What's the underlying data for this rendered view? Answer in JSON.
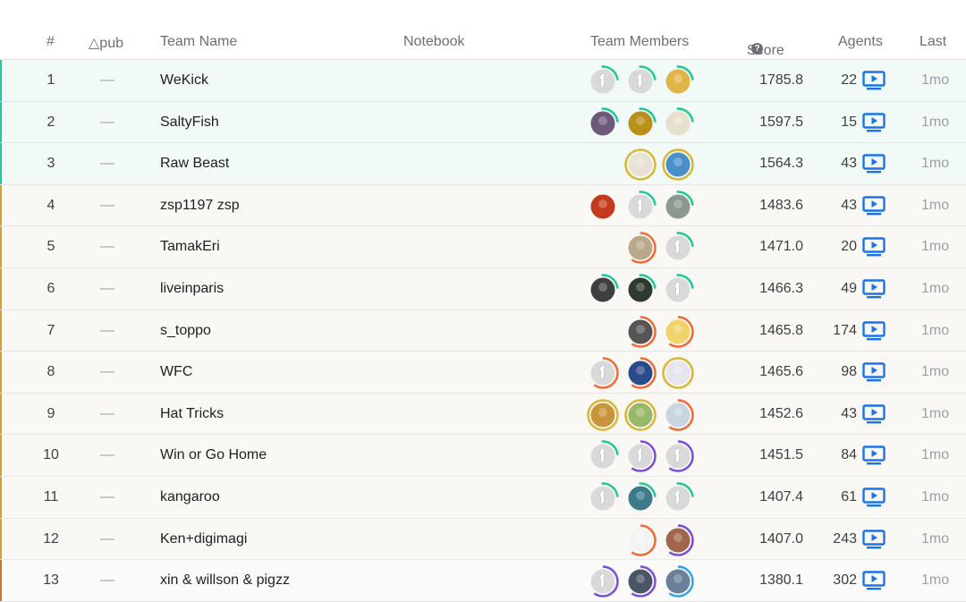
{
  "header": {
    "rank": "#",
    "delta": "△pub",
    "team_name": "Team Name",
    "notebook": "Notebook",
    "team_members": "Team Members",
    "score": "Score",
    "agents": "Agents",
    "last": "Last"
  },
  "icons": {
    "score_help": "question-circle-icon",
    "watch": "play-episode-icon"
  },
  "colors": {
    "gold_tier": "#20c997",
    "silver_tier": "#d69e2e",
    "bronze_tier": "#c7792a",
    "watch_blue": "#1a73e8",
    "tier_ring_green": "#20c997",
    "tier_ring_orange": "#f06a35",
    "tier_ring_purple": "#7b4ddb",
    "tier_ring_gold": "#d9b634",
    "tier_ring_blue": "#2fa4e7"
  },
  "rows": [
    {
      "rank": "1",
      "delta": "—",
      "team": "WeKick",
      "score": "1785.8",
      "agents": "22",
      "last": "1mo",
      "tier": "gold",
      "members": [
        {
          "ring": "green",
          "fill": "#d9d9d9",
          "kind": "goose"
        },
        {
          "ring": "green",
          "fill": "#d9d9d9",
          "kind": "goose"
        },
        {
          "ring": "green",
          "fill": "#e0b548",
          "kind": "photo"
        }
      ]
    },
    {
      "rank": "2",
      "delta": "—",
      "team": "SaltyFish",
      "score": "1597.5",
      "agents": "15",
      "last": "1mo",
      "tier": "gold",
      "members": [
        {
          "ring": "green",
          "fill": "#6d5a7a",
          "kind": "photo"
        },
        {
          "ring": "green",
          "fill": "#b8901a",
          "kind": "photo"
        },
        {
          "ring": "green",
          "fill": "#e4e0cc",
          "kind": "photo"
        }
      ]
    },
    {
      "rank": "3",
      "delta": "—",
      "team": "Raw Beast",
      "score": "1564.3",
      "agents": "43",
      "last": "1mo",
      "tier": "gold",
      "members": [
        {
          "ring": "gold",
          "fill": "#e9e2d4",
          "kind": "photo"
        },
        {
          "ring": "gold",
          "fill": "#4a90c8",
          "kind": "photo"
        }
      ]
    },
    {
      "rank": "4",
      "delta": "—",
      "team": "zsp1197 zsp",
      "score": "1483.6",
      "agents": "43",
      "last": "1mo",
      "tier": "silver",
      "members": [
        {
          "ring": "none",
          "fill": "#c43a1c",
          "kind": "photo"
        },
        {
          "ring": "green",
          "fill": "#d9d9d9",
          "kind": "goose"
        },
        {
          "ring": "green",
          "fill": "#8a9a90",
          "kind": "photo"
        }
      ]
    },
    {
      "rank": "5",
      "delta": "—",
      "team": "TamakEri",
      "score": "1471.0",
      "agents": "20",
      "last": "1mo",
      "tier": "silver",
      "members": [
        {
          "ring": "orange",
          "fill": "#b9a88a",
          "kind": "photo"
        },
        {
          "ring": "green",
          "fill": "#d9d9d9",
          "kind": "goose"
        }
      ]
    },
    {
      "rank": "6",
      "delta": "—",
      "team": "liveinparis",
      "score": "1466.3",
      "agents": "49",
      "last": "1mo",
      "tier": "silver",
      "members": [
        {
          "ring": "green",
          "fill": "#3f3f3f",
          "kind": "photo"
        },
        {
          "ring": "green",
          "fill": "#2f3a2e",
          "kind": "photo"
        },
        {
          "ring": "green",
          "fill": "#d9d9d9",
          "kind": "goose"
        }
      ]
    },
    {
      "rank": "7",
      "delta": "—",
      "team": "s_toppo",
      "score": "1465.8",
      "agents": "174",
      "last": "1mo",
      "tier": "silver",
      "members": [
        {
          "ring": "orange",
          "fill": "#555555",
          "kind": "photo"
        },
        {
          "ring": "orange",
          "fill": "#f2d36a",
          "kind": "photo"
        }
      ]
    },
    {
      "rank": "8",
      "delta": "—",
      "team": "WFC",
      "score": "1465.6",
      "agents": "98",
      "last": "1mo",
      "tier": "silver",
      "members": [
        {
          "ring": "orange",
          "fill": "#d9d9d9",
          "kind": "goose"
        },
        {
          "ring": "orange",
          "fill": "#2a4a8a",
          "kind": "photo"
        },
        {
          "ring": "gold",
          "fill": "#e8e4ee",
          "kind": "photo"
        }
      ]
    },
    {
      "rank": "9",
      "delta": "—",
      "team": "Hat Tricks",
      "score": "1452.6",
      "agents": "43",
      "last": "1mo",
      "tier": "silver",
      "members": [
        {
          "ring": "gold",
          "fill": "#c8953a",
          "kind": "photo"
        },
        {
          "ring": "gold",
          "fill": "#9ab86a",
          "kind": "photo"
        },
        {
          "ring": "orange",
          "fill": "#c9d6e0",
          "kind": "photo"
        }
      ]
    },
    {
      "rank": "10",
      "delta": "—",
      "team": "Win or Go Home",
      "score": "1451.5",
      "agents": "84",
      "last": "1mo",
      "tier": "silver",
      "members": [
        {
          "ring": "green",
          "fill": "#d9d9d9",
          "kind": "goose"
        },
        {
          "ring": "purple",
          "fill": "#d9d9d9",
          "kind": "goose"
        },
        {
          "ring": "purple",
          "fill": "#d9d9d9",
          "kind": "goose"
        }
      ]
    },
    {
      "rank": "11",
      "delta": "—",
      "team": "kangaroo",
      "score": "1407.4",
      "agents": "61",
      "last": "1mo",
      "tier": "silver",
      "members": [
        {
          "ring": "green",
          "fill": "#d9d9d9",
          "kind": "goose"
        },
        {
          "ring": "green",
          "fill": "#3d7a8a",
          "kind": "photo"
        },
        {
          "ring": "green",
          "fill": "#d9d9d9",
          "kind": "goose"
        }
      ]
    },
    {
      "rank": "12",
      "delta": "—",
      "team": "Ken+digimagi",
      "score": "1407.0",
      "agents": "243",
      "last": "1mo",
      "tier": "silver",
      "members": [
        {
          "ring": "orange",
          "fill": "#f4f4f4",
          "kind": "photo"
        },
        {
          "ring": "purple",
          "fill": "#a0654a",
          "kind": "photo"
        }
      ]
    },
    {
      "rank": "13",
      "delta": "—",
      "team": "xin & willson & pigzz",
      "score": "1380.1",
      "agents": "302",
      "last": "1mo",
      "tier": "bronze",
      "members": [
        {
          "ring": "purple",
          "fill": "#d9d9d9",
          "kind": "goose"
        },
        {
          "ring": "purple",
          "fill": "#4a5568",
          "kind": "photo"
        },
        {
          "ring": "blue",
          "fill": "#6a7f99",
          "kind": "photo"
        }
      ]
    }
  ]
}
